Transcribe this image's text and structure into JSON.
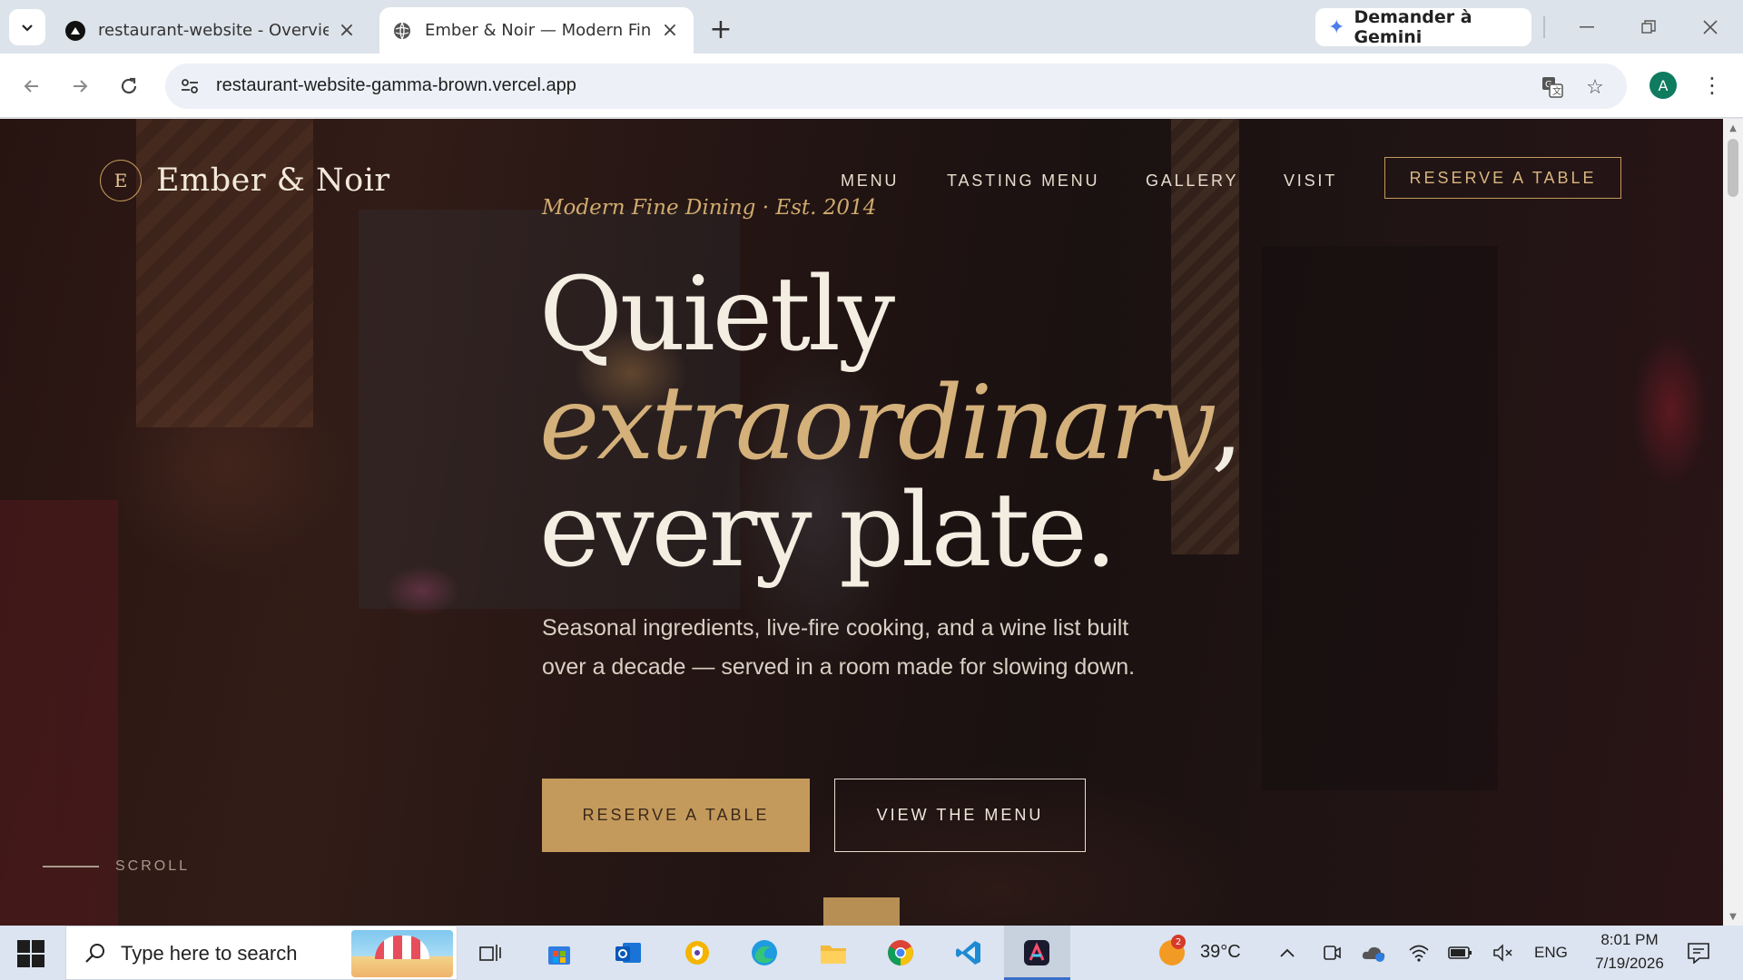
{
  "browser": {
    "tabs": [
      {
        "title": "restaurant-website - Overview -",
        "active": false
      },
      {
        "title": "Ember & Noir — Modern Fine D",
        "active": true
      }
    ],
    "new_tab": "+",
    "gemini_label": "Demander à Gemini",
    "url": "restaurant-website-gamma-brown.vercel.app",
    "profile_initial": "A"
  },
  "site": {
    "brand_mark": "E",
    "brand_name": "Ember & Noir",
    "nav": [
      "MENU",
      "TASTING MENU",
      "GALLERY",
      "VISIT"
    ],
    "nav_cta": "RESERVE A TABLE",
    "eyebrow": "Modern Fine Dining · Est. 2014",
    "headline": {
      "line1": "Quietly",
      "line2": "extraordinary",
      "line2_comma": ",",
      "line3": "every plate."
    },
    "lede": "Seasonal ingredients, live-fire cooking, and a wine list built over a decade — served in a room made for slowing down.",
    "primary_cta": "RESERVE A TABLE",
    "secondary_cta": "VIEW THE MENU",
    "scroll_label": "SCROLL",
    "colors": {
      "accent": "#c49a5c",
      "text": "#f4ede2",
      "background": "#2a1714"
    }
  },
  "taskbar": {
    "search_placeholder": "Type here to search",
    "weather_temp": "39°C",
    "weather_badge": "2",
    "language": "ENG",
    "time": "8:01 PM",
    "date": "7/19/2026"
  }
}
